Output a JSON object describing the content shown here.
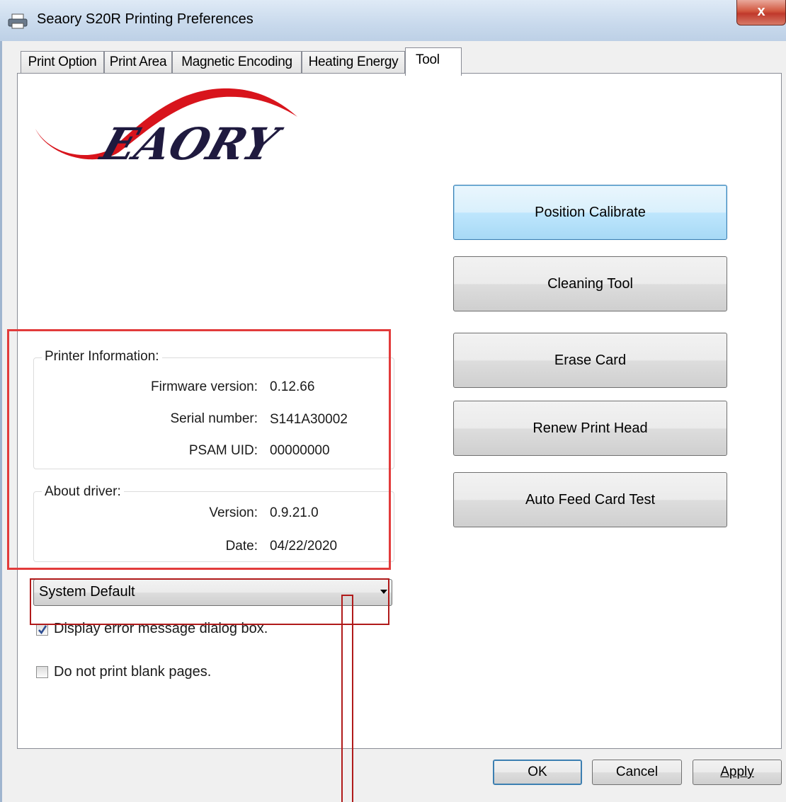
{
  "window": {
    "title": "Seaory S20R Printing Preferences",
    "close_label": "x"
  },
  "tabs": [
    {
      "label": "Print Option"
    },
    {
      "label": "Print Area"
    },
    {
      "label": "Magnetic Encoding"
    },
    {
      "label": "Heating Energy"
    },
    {
      "label": "Tool",
      "active": true
    }
  ],
  "logo": {
    "brand_text": "EAORY"
  },
  "printer_info": {
    "title": "Printer Information:",
    "firmware_label": "Firmware version:",
    "firmware_value": "0.12.66",
    "serial_label": "Serial number:",
    "serial_value": "S141A30002",
    "psam_label": "PSAM UID:",
    "psam_value": "00000000"
  },
  "about_driver": {
    "title": "About driver:",
    "version_label": "Version:",
    "version_value": "0.9.21.0",
    "date_label": "Date:",
    "date_value": "04/22/2020"
  },
  "tool_buttons": {
    "position_calibrate": "Position Calibrate",
    "cleaning_tool": "Cleaning Tool",
    "erase_card": "Erase Card",
    "renew_print_head": "Renew Print Head",
    "auto_feed_card_test": "Auto Feed Card Test"
  },
  "language_select": {
    "selected": "System Default"
  },
  "options": {
    "display_error": {
      "label": "Display error message dialog box.",
      "checked": true
    },
    "no_blank_pages": {
      "label": "Do not print blank pages.",
      "checked": false
    }
  },
  "dialog_buttons": {
    "ok": "OK",
    "cancel": "Cancel",
    "apply": "Apply"
  },
  "colors": {
    "annotation_red": "#e23b3b",
    "annotation_dark_red": "#b01a1a",
    "logo_red": "#d8141c",
    "logo_dark": "#1f1a3f"
  }
}
